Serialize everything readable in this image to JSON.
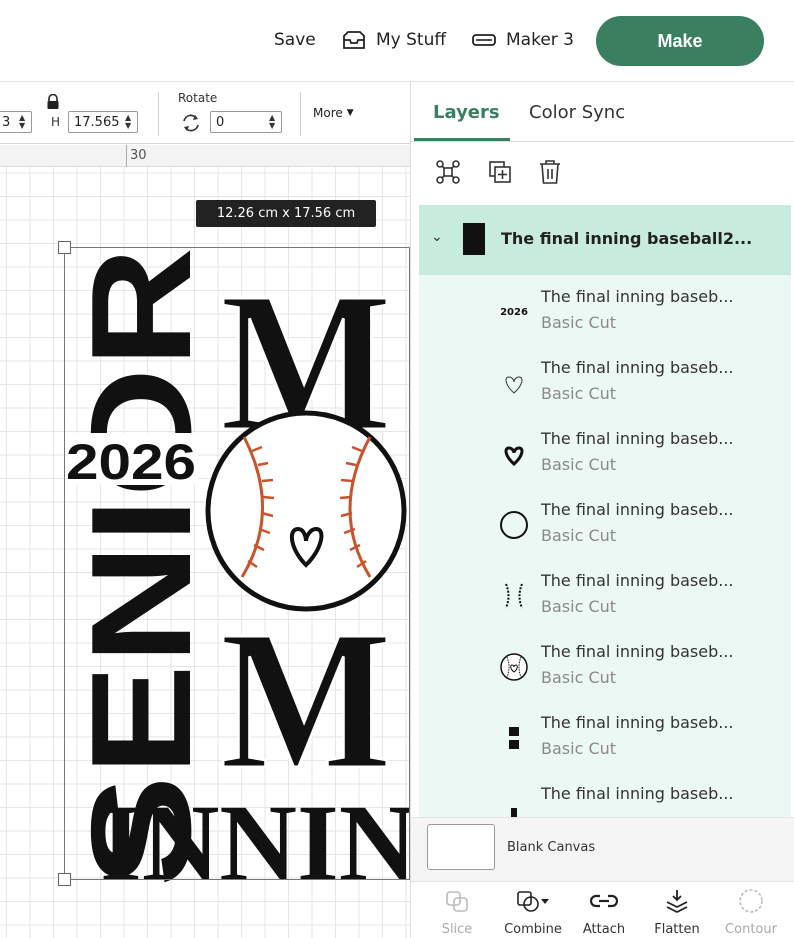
{
  "topbar": {
    "save_label": "Save",
    "mystuff_label": "My Stuff",
    "machine_label": "Maker 3",
    "make_label": "Make"
  },
  "toolbar": {
    "w_value": "3",
    "h_label": "H",
    "h_value": "17.565",
    "rotate_label": "Rotate",
    "rotate_value": "0",
    "more_label": "More"
  },
  "canvas": {
    "ruler_label": "30",
    "dimension_tooltip": "12.26  cm x 17.56  cm",
    "design_text": {
      "senior": "SENIOR",
      "year": "2026",
      "mom_top": "M",
      "mom_bottom": "M",
      "inning": "INNING"
    }
  },
  "panel": {
    "tabs": [
      {
        "label": "Layers",
        "active": true
      },
      {
        "label": "Color Sync",
        "active": false
      }
    ],
    "group": {
      "name": "The final inning baseball2..."
    },
    "layers": [
      {
        "name": "The final inning baseb...",
        "type": "Basic Cut",
        "thumb": "2026-text-icon",
        "thumb_text": "2026"
      },
      {
        "name": "The final inning baseb...",
        "type": "Basic Cut",
        "thumb": "heart-outline-icon"
      },
      {
        "name": "The final inning baseb...",
        "type": "Basic Cut",
        "thumb": "heart-filled-icon"
      },
      {
        "name": "The final inning baseb...",
        "type": "Basic Cut",
        "thumb": "circle-icon"
      },
      {
        "name": "The final inning baseb...",
        "type": "Basic Cut",
        "thumb": "stitches-icon"
      },
      {
        "name": "The final inning baseb...",
        "type": "Basic Cut",
        "thumb": "baseball-icon"
      },
      {
        "name": "The final inning baseb...",
        "type": "Basic Cut",
        "thumb": "m-letters-icon"
      },
      {
        "name": "The final inning baseb...",
        "type": "",
        "thumb": "senior-text-icon"
      }
    ],
    "blank_canvas_label": "Blank Canvas",
    "actions": [
      {
        "label": "Slice",
        "enabled": false
      },
      {
        "label": "Combine",
        "enabled": true
      },
      {
        "label": "Attach",
        "enabled": true
      },
      {
        "label": "Flatten",
        "enabled": true
      },
      {
        "label": "Contour",
        "enabled": false
      }
    ]
  },
  "colors": {
    "accent": "#3a8060",
    "layer_selected_bg": "#c7ebdc",
    "layer_bg": "#ebf8f3",
    "stitch": "#c9532a"
  }
}
